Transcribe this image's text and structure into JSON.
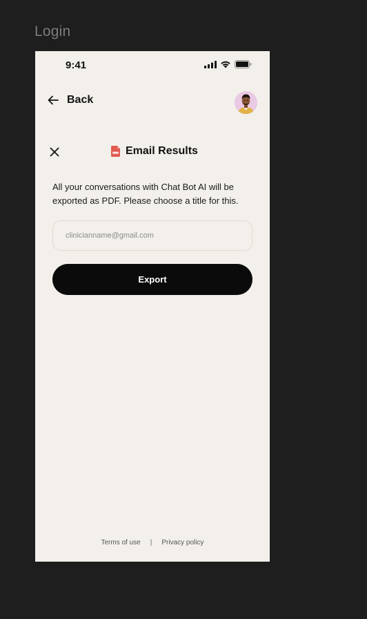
{
  "canvas": {
    "frame_label": "Login"
  },
  "status_bar": {
    "time": "9:41",
    "icons": [
      "cellular-signal-icon",
      "wifi-icon",
      "battery-icon"
    ]
  },
  "header": {
    "back_label": "Back",
    "back_icon": "arrow-left-icon",
    "avatar": "user-avatar"
  },
  "sheet": {
    "close_icon": "close-icon",
    "title_icon": "pdf-file-icon",
    "title": "Email Results",
    "description": "All your conversations with Chat Bot AI will be exported as PDF. Please choose a title for this.",
    "email_placeholder": "clinicianname@gmail.com",
    "email_value": "",
    "export_label": "Export"
  },
  "footer": {
    "terms_label": "Terms of use",
    "separator": "|",
    "privacy_label": "Privacy policy"
  },
  "colors": {
    "canvas_bg": "#1e1e1e",
    "screen_bg": "#f3f0eb",
    "primary_button": "#0b0b0b",
    "pdf_icon": "#e05a4f",
    "avatar_bg": "#e9c9e4",
    "text_primary": "#111111"
  }
}
